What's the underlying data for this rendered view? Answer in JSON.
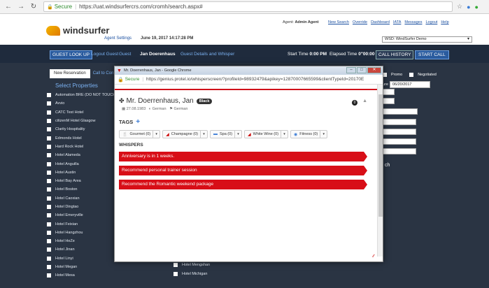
{
  "browser": {
    "secure_label": "Secure",
    "url": "https://uat.windsurfercrs.com/cromh/search.aspx#"
  },
  "header": {
    "logo_text": "windsurfer",
    "agent_label": "Agent: ",
    "agent_name": "Admin Agent",
    "links": [
      "New Search",
      "Override",
      "Dashboard",
      "IATA",
      "Messages",
      "Logout",
      "Help"
    ],
    "agent_settings": "Agent Settings",
    "datetime": "June 19, 2017 14:17:28 PM",
    "wsd_select": "WSD: WindSurfer Demo"
  },
  "toolbar": {
    "guest_lookup": "GUEST LOOK UP",
    "logout_guest": "Logout Guest",
    "guest_label": "Guest",
    "guest_name": "Jan  Doerenhaus",
    "guest_details": "Guest Details and Whisper",
    "start_time_label": "Start Time",
    "start_time": "0:00 PM",
    "elapsed_label": "Elapsed Time",
    "elapsed_time": "0\"00:00",
    "call_history": "CALL HISTORY",
    "start_call": "START CALL"
  },
  "tabs": [
    "New Reservation",
    "Call to Con"
  ],
  "select_properties": "Select Properties",
  "properties_col1": [
    "Automation BRE (DO NOT TOUCH)",
    "Avvio",
    "CATC Test Hotel",
    "citizenM Hotel Glasgow",
    "Clarity Hospitality",
    "Edmonds Hotel",
    "Hard Rock Hotel",
    "Hotel Alameda",
    "Hotel Anguilla",
    "Hotel Austin",
    "Hotel Bay Area",
    "Hotel Boston",
    "Hotel Caoxian",
    "Hotel Dingtao",
    "Hotel Emeryville",
    "Hotel Feixian",
    "Hotel Hangzhou",
    "Hotel HeZe",
    "Hotel Jinan",
    "Hotel Linyi",
    "Hotel Megan",
    "Hotel Mesa"
  ],
  "properties_col2": [
    "Hotel Manila",
    "Hotel Mengshan",
    "Hotel Michigan"
  ],
  "right_form": {
    "promo": "Promo",
    "negotiated": "Negotiated",
    "date_label": "ure",
    "date_value": "06/20/2017",
    "search_label": "ch"
  },
  "popup": {
    "window_title": "Mr. Doerrenhaus, Jan - Google Chrome",
    "secure_label": "Secure",
    "url": "https://genius.protel.io/whisperscreen/?profileId=98932479&apikey=12870007665599&clientTypeId=20170E",
    "guest_name": "Mr. Doerrenhaus, Jan",
    "status_badge": "Black",
    "count": "0",
    "dob": "27.08.1983",
    "nationality": "German",
    "language": "German",
    "tags_label": "TAGS",
    "tags": [
      {
        "icon": "utensils-icon",
        "label": "Gourmet (0)"
      },
      {
        "icon": "glass-icon",
        "label": "Champagne (0)"
      },
      {
        "icon": "bed-icon",
        "label": "Spa (0)"
      },
      {
        "icon": "glass-icon",
        "label": "White Wine (0)"
      },
      {
        "icon": "fitness-icon",
        "label": "Fitness (0)"
      }
    ],
    "whispers_label": "WHISPERS",
    "whispers": [
      "Anniversary is in 1 weeks.",
      "Recommend personal trainer session",
      "Recommend the Romantic weekend package"
    ]
  },
  "colors": {
    "dark_bg": "#2a3443",
    "accent_blue": "#2a5b9e",
    "whisper_red": "#d80e17"
  }
}
